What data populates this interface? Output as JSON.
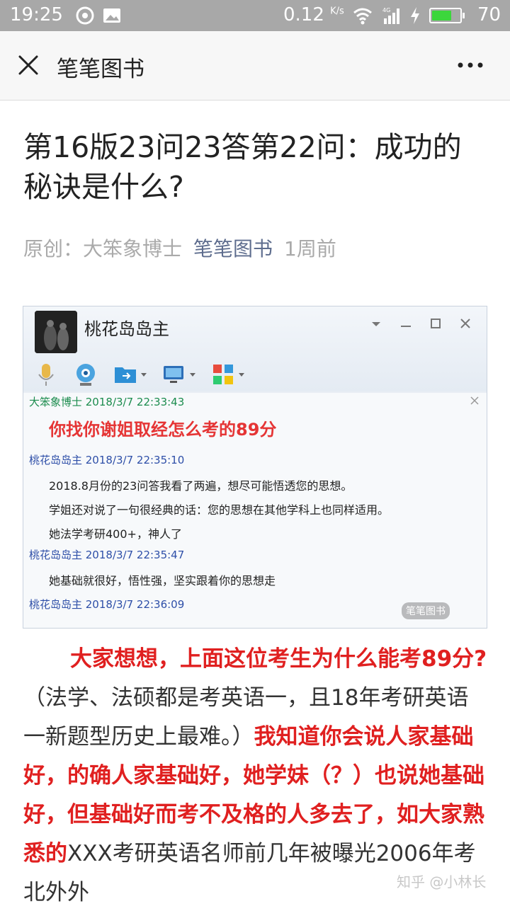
{
  "status_bar": {
    "time": "19:25",
    "net_speed": "0.12",
    "net_speed_unit": "K/s",
    "network_type": "4G",
    "battery_percent": "70",
    "battery_level": 0.7
  },
  "navbar": {
    "close_icon": "close-icon",
    "title": "笔笔图书",
    "more_icon": "more-icon"
  },
  "article": {
    "title": "第16版23问23答第22问：成功的秘诀是什么?",
    "meta_prefix": "原创：大笨象博士",
    "meta_source": "笔笔图书",
    "meta_time": "1周前"
  },
  "embedded_image": {
    "window_title": "桃花岛岛主",
    "messages": [
      {
        "header": "大笨象博士 2018/3/7 22:33:43",
        "lines": [
          "你找你谢姐取经怎么考的89分"
        ]
      },
      {
        "header": "桃花岛岛主 2018/3/7 22:35:10",
        "lines": [
          "2018.8月份的23问答我看了两遍，想尽可能悟透您的思想。",
          "学姐还对说了一句很经典的话：您的思想在其他学科上也同样适用。",
          "她法学考研400+，神人了"
        ]
      },
      {
        "header": "桃花岛岛主 2018/3/7 22:35:47",
        "lines": [
          "她基础就很好，悟性强，坚实跟着你的思想走"
        ]
      },
      {
        "header": "桃花岛岛主 2018/3/7 22:36:09",
        "lines": []
      }
    ],
    "watermark": "笔笔图书"
  },
  "body": {
    "s1_red": "大家想想，上面这位考生为什么能考89分?",
    "s1_normal": "（法学、法硕都是考英语一，且18年考研英语一新题型历史上最难。）",
    "s2_red": "我知道你会说人家基础好，的确人家基础好，她学妹（？）也说她基础好，但基础好而考不及格的人多去了，如大家熟悉的",
    "s2_normal": "XXX考研英语名师前几年被曝光2006年考北外外"
  },
  "watermark_zhihu": "知乎 @小林长"
}
